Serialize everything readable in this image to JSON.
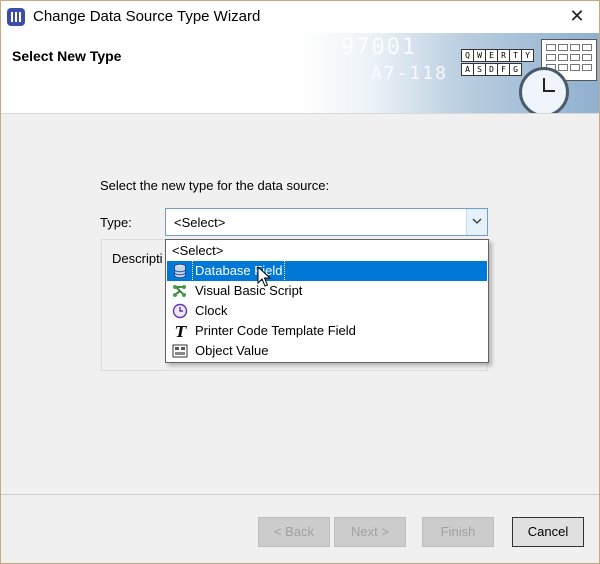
{
  "window": {
    "title": "Change Data Source Type Wizard",
    "close_glyph": "✕"
  },
  "header": {
    "title": "Select New Type",
    "banner_text_1": "97001",
    "banner_text_2": "A7-118",
    "banner_keys": [
      "Q",
      "W",
      "E",
      "R",
      "T",
      "Y",
      "A",
      "S",
      "D",
      "F",
      "G"
    ]
  },
  "main": {
    "prompt": "Select the new type for the data source:",
    "type_label": "Type:",
    "type_value": "<Select>",
    "description_label": "Descripti"
  },
  "dropdown": {
    "options": [
      {
        "label": "<Select>",
        "icon": "none"
      },
      {
        "label": "Database Field",
        "icon": "database-icon",
        "selected": true
      },
      {
        "label": "Visual Basic Script",
        "icon": "script-icon"
      },
      {
        "label": "Clock",
        "icon": "clock-icon"
      },
      {
        "label": "Printer Code Template Field",
        "icon": "printer-code-icon"
      },
      {
        "label": "Object Value",
        "icon": "object-value-icon"
      }
    ]
  },
  "footer": {
    "back_label": "< Back",
    "next_label": "Next >",
    "finish_label": "Finish",
    "cancel_label": "Cancel"
  },
  "colors": {
    "selection": "#0078d7",
    "focus_border": "#6f9ed6",
    "title_icon": "#3b4fa8"
  }
}
